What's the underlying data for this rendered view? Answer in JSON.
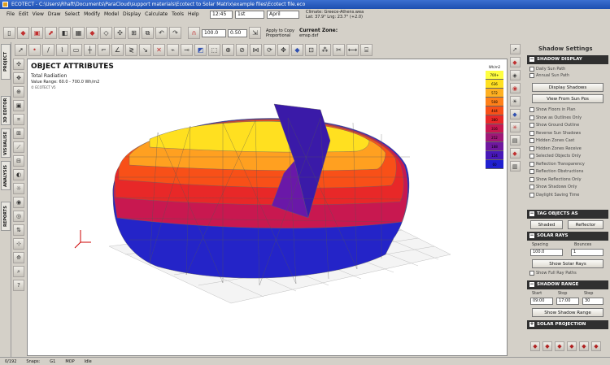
{
  "window": {
    "title": "ECOTECT - C:\\Users\\Rhaft\\Documents\\ParaCloud\\support materials\\Ecotect to Solar Matrix\\example files\\Ecotect file.eco"
  },
  "menu": [
    "File",
    "Edit",
    "View",
    "Draw",
    "Select",
    "Modify",
    "Model",
    "Display",
    "Calculate",
    "Tools",
    "Help"
  ],
  "top_controls": {
    "time": "12:45",
    "day": "1st",
    "month": "April"
  },
  "climate": {
    "line1": "Climate: Greece-Athens.wea",
    "line2": "Lat: 37.9°   Lng: 23.7° (+2.0)"
  },
  "toolbar_row1": {
    "zoom": "100.0",
    "offset": "0.50",
    "apply_label": "Apply to Copy",
    "proportional_label": "Proportional",
    "current_zone_label": "Current Zone:",
    "current_zone_value": "emsp.dxf"
  },
  "side_tabs": [
    "PROJECT",
    "3D EDITOR",
    "VISUALISE",
    "ANALYSIS",
    "REPORTS"
  ],
  "viewport": {
    "title": "OBJECT ATTRIBUTES",
    "subtitle": "Total Radiation",
    "range": "Value Range: 60.0 - 700.0 Wh/m2",
    "timestamp": "© ECOTECT V5"
  },
  "legend": {
    "unit": "Wh/m2",
    "items": [
      {
        "label": "700+",
        "color": "#ffff40"
      },
      {
        "label": "636",
        "color": "#ffe020"
      },
      {
        "label": "572",
        "color": "#ffb020"
      },
      {
        "label": "508",
        "color": "#ff8018"
      },
      {
        "label": "444",
        "color": "#f85018"
      },
      {
        "label": "380",
        "color": "#e82828"
      },
      {
        "label": "316",
        "color": "#c81850"
      },
      {
        "label": "252",
        "color": "#a01878"
      },
      {
        "label": "188",
        "color": "#7018a0"
      },
      {
        "label": "124",
        "color": "#4818b8"
      },
      {
        "label": "60",
        "color": "#2020d0"
      }
    ]
  },
  "right_panel": {
    "title": "Shadow Settings",
    "shadow_display": {
      "header": "SHADOW DISPLAY",
      "checks": [
        "Daily Sun Path",
        "Annual Sun Path"
      ],
      "btn_display": "Display Shadows",
      "btn_view": "View From Sun Pos",
      "checks2": [
        "Show Floors in Plan",
        "Show as Outlines Only",
        "Show Ground Outline",
        "Reverse Sun Shadows",
        "Hidden Zones Cast",
        "Hidden Zones Receive",
        "Selected Objects Only",
        "Reflection Transparency",
        "Reflection Obstructions",
        "Show Reflections Only",
        "Show Shadows Only",
        "Daylight Saving Time"
      ]
    },
    "tag_objects": {
      "header": "TAG OBJECTS AS",
      "btn_shaded": "Shaded",
      "btn_reflector": "Reflector"
    },
    "solar_rays": {
      "header": "SOLAR RAYS",
      "spacing_label": "Spacing",
      "bounces_label": "Bounces",
      "spacing": "100.0",
      "bounces": "1",
      "btn_show": "Show Solar Rays",
      "check_full": "Show Full Ray Paths"
    },
    "shadow_range": {
      "header": "SHADOW RANGE",
      "start_label": "Start",
      "stop_label": "Stop",
      "step_label": "Step",
      "start": "09:00",
      "stop": "17:00",
      "step": "30",
      "btn_show": "Show Shadow Range"
    },
    "solar_projection": {
      "header": "SOLAR PROJECTION"
    }
  },
  "status": {
    "count": "0/192",
    "snaps": "Snaps:",
    "g1": "G1",
    "mode": "MOP",
    "state": "Idle"
  }
}
